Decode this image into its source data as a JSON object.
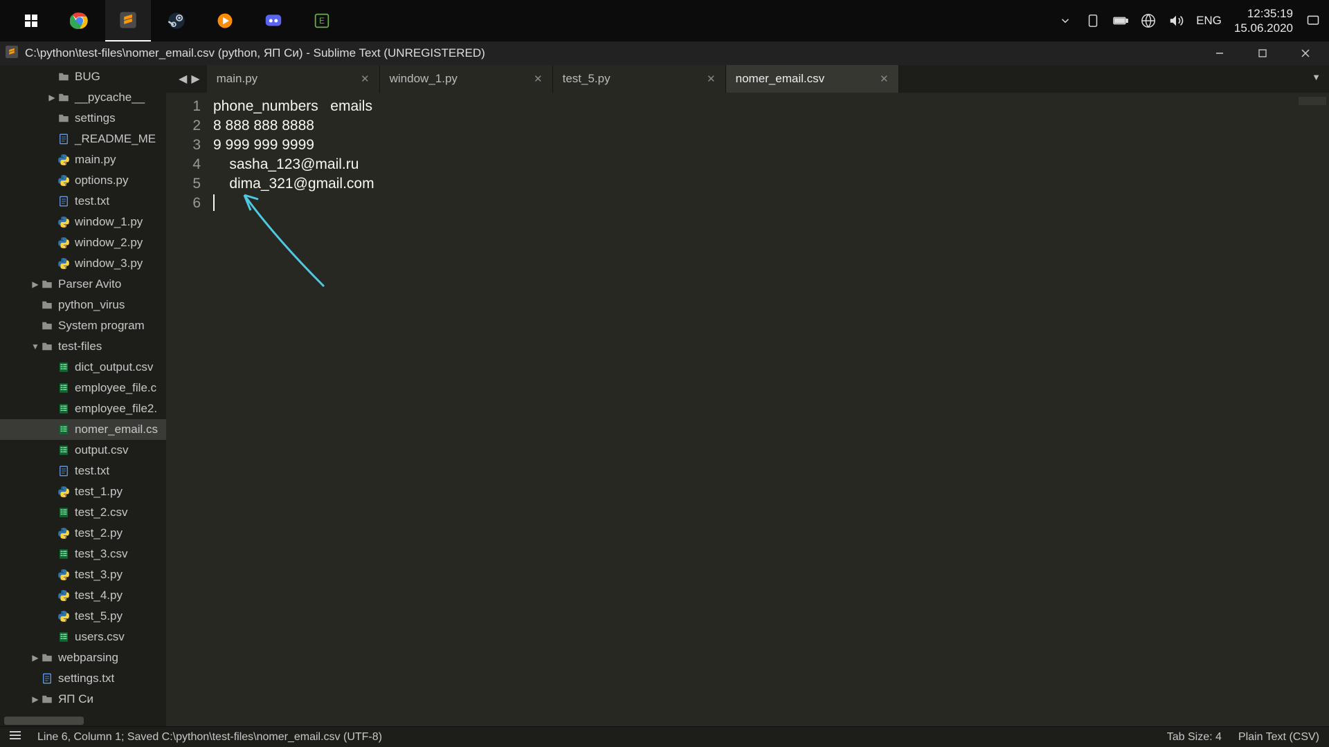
{
  "taskbar": {
    "icons": [
      "windows",
      "chrome",
      "sublime",
      "steam",
      "media",
      "discord",
      "stream"
    ],
    "lang": "ENG",
    "time": "12:35:19",
    "date": "15.06.2020"
  },
  "window": {
    "title": "C:\\python\\test-files\\nomer_email.csv (python, ЯП Си) - Sublime Text (UNREGISTERED)"
  },
  "sidebar": [
    {
      "depth": 2,
      "caret": "",
      "kind": "folder",
      "label": "BUG"
    },
    {
      "depth": 2,
      "caret": "▶",
      "kind": "folder",
      "label": "__pycache__"
    },
    {
      "depth": 2,
      "caret": "",
      "kind": "folder",
      "label": "settings"
    },
    {
      "depth": 2,
      "caret": "",
      "kind": "txt",
      "label": "_README_ME"
    },
    {
      "depth": 2,
      "caret": "",
      "kind": "py",
      "label": "main.py"
    },
    {
      "depth": 2,
      "caret": "",
      "kind": "py",
      "label": "options.py"
    },
    {
      "depth": 2,
      "caret": "",
      "kind": "txt",
      "label": "test.txt"
    },
    {
      "depth": 2,
      "caret": "",
      "kind": "py",
      "label": "window_1.py"
    },
    {
      "depth": 2,
      "caret": "",
      "kind": "py",
      "label": "window_2.py"
    },
    {
      "depth": 2,
      "caret": "",
      "kind": "py",
      "label": "window_3.py"
    },
    {
      "depth": 1,
      "caret": "▶",
      "kind": "folder",
      "label": "Parser Avito"
    },
    {
      "depth": 1,
      "caret": "",
      "kind": "folder",
      "label": "python_virus"
    },
    {
      "depth": 1,
      "caret": "",
      "kind": "folder",
      "label": "System program"
    },
    {
      "depth": 1,
      "caret": "▼",
      "kind": "folder",
      "label": "test-files"
    },
    {
      "depth": 2,
      "caret": "",
      "kind": "csv",
      "label": "dict_output.csv"
    },
    {
      "depth": 2,
      "caret": "",
      "kind": "csv",
      "label": "employee_file.c"
    },
    {
      "depth": 2,
      "caret": "",
      "kind": "csv",
      "label": "employee_file2."
    },
    {
      "depth": 2,
      "caret": "",
      "kind": "csv",
      "label": "nomer_email.cs",
      "selected": true
    },
    {
      "depth": 2,
      "caret": "",
      "kind": "csv",
      "label": "output.csv"
    },
    {
      "depth": 2,
      "caret": "",
      "kind": "txt",
      "label": "test.txt"
    },
    {
      "depth": 2,
      "caret": "",
      "kind": "py",
      "label": "test_1.py"
    },
    {
      "depth": 2,
      "caret": "",
      "kind": "csv",
      "label": "test_2.csv"
    },
    {
      "depth": 2,
      "caret": "",
      "kind": "py",
      "label": "test_2.py"
    },
    {
      "depth": 2,
      "caret": "",
      "kind": "csv",
      "label": "test_3.csv"
    },
    {
      "depth": 2,
      "caret": "",
      "kind": "py",
      "label": "test_3.py"
    },
    {
      "depth": 2,
      "caret": "",
      "kind": "py",
      "label": "test_4.py"
    },
    {
      "depth": 2,
      "caret": "",
      "kind": "py",
      "label": "test_5.py"
    },
    {
      "depth": 2,
      "caret": "",
      "kind": "csv",
      "label": "users.csv"
    },
    {
      "depth": 1,
      "caret": "▶",
      "kind": "folder",
      "label": "webparsing"
    },
    {
      "depth": 1,
      "caret": "",
      "kind": "txt",
      "label": "settings.txt"
    },
    {
      "depth": 1,
      "caret": "▶",
      "kind": "folder",
      "label": "ЯП Си"
    }
  ],
  "tabs": [
    {
      "label": "main.py",
      "active": false
    },
    {
      "label": "window_1.py",
      "active": false
    },
    {
      "label": "test_5.py",
      "active": false
    },
    {
      "label": "nomer_email.csv",
      "active": true
    }
  ],
  "editor": {
    "lines": [
      "phone_numbers   emails",
      "8 888 888 8888",
      "9 999 999 9999",
      "    sasha_123@mail.ru",
      "    dima_321@gmail.com",
      ""
    ]
  },
  "status": {
    "left": "Line 6, Column 1; Saved C:\\python\\test-files\\nomer_email.csv (UTF-8)",
    "tabsize": "Tab Size: 4",
    "syntax": "Plain Text (CSV)"
  }
}
